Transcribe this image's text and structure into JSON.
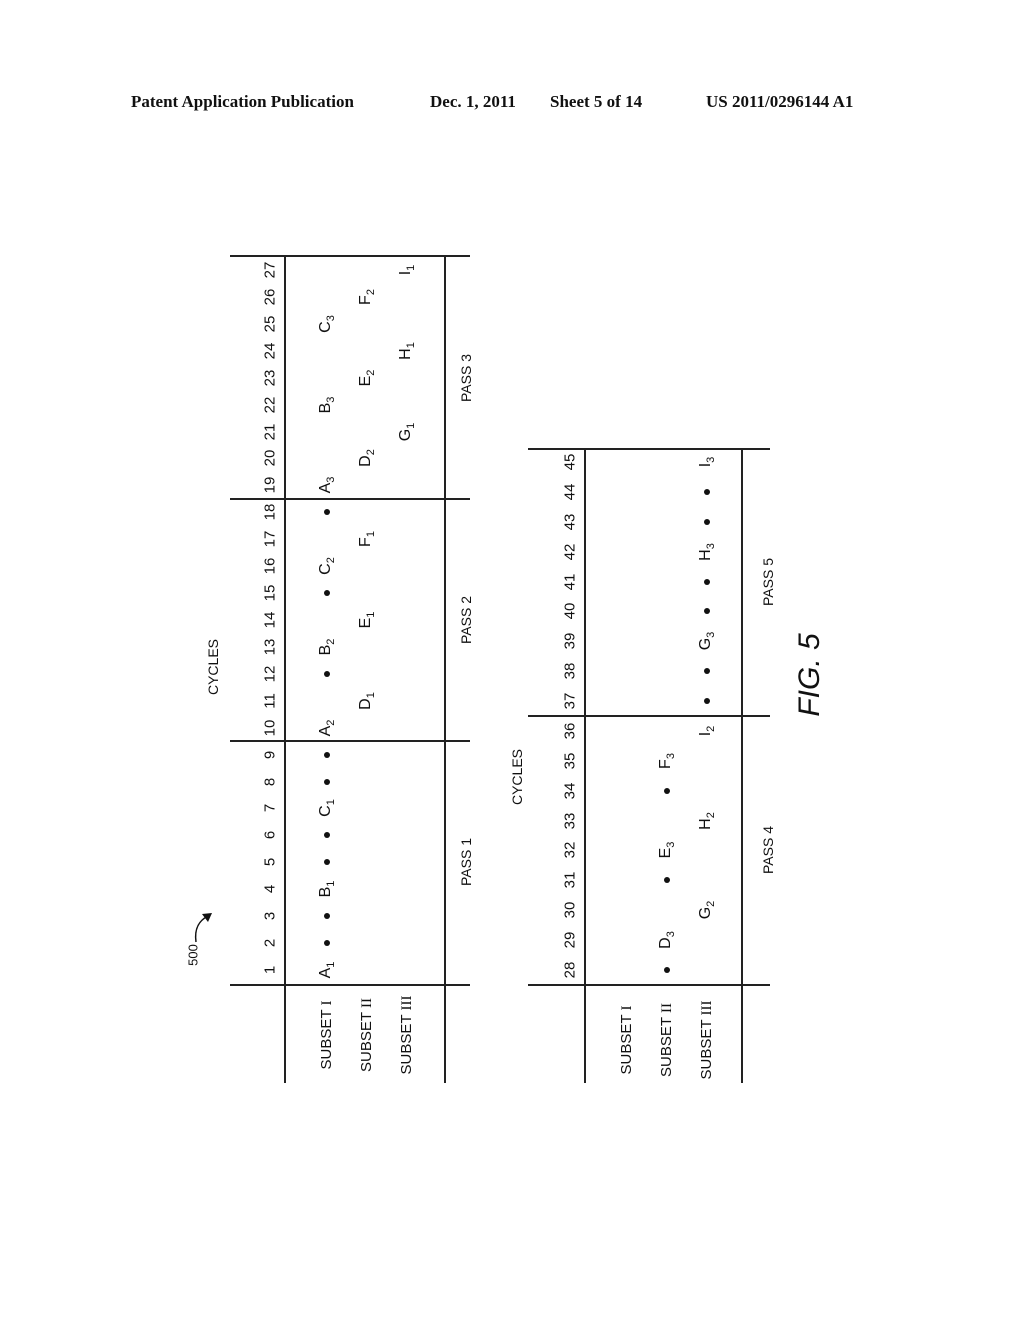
{
  "header": {
    "publication": "Patent Application Publication",
    "date": "Dec. 1, 2011",
    "sheet": "Sheet 5 of 14",
    "number": "US 2011/0296144 A1"
  },
  "figure": {
    "label": "FIG. 5",
    "reference": "500",
    "cycles_label": "CYCLES",
    "subset_labels": [
      "SUBSET I",
      "SUBSET II",
      "SUBSET III"
    ],
    "tables": [
      {
        "cycles": [
          1,
          2,
          3,
          4,
          5,
          6,
          7,
          8,
          9,
          10,
          11,
          12,
          13,
          14,
          15,
          16,
          17,
          18,
          19,
          20,
          21,
          22,
          23,
          24,
          25,
          26,
          27
        ],
        "passes": [
          {
            "label": "PASS 1",
            "from": 1,
            "to": 9
          },
          {
            "label": "PASS 2",
            "from": 10,
            "to": 18
          },
          {
            "label": "PASS 3",
            "from": 19,
            "to": 27
          }
        ],
        "rows": [
          [
            {
              "cycle": 1,
              "text": "A",
              "sub": "1"
            },
            {
              "cycle": 2,
              "dot": true
            },
            {
              "cycle": 3,
              "dot": true
            },
            {
              "cycle": 4,
              "text": "B",
              "sub": "1"
            },
            {
              "cycle": 5,
              "dot": true
            },
            {
              "cycle": 6,
              "dot": true
            },
            {
              "cycle": 7,
              "text": "C",
              "sub": "1"
            },
            {
              "cycle": 8,
              "dot": true
            },
            {
              "cycle": 9,
              "dot": true
            },
            {
              "cycle": 10,
              "text": "A",
              "sub": "2"
            },
            {
              "cycle": 12,
              "dot": true
            },
            {
              "cycle": 13,
              "text": "B",
              "sub": "2"
            },
            {
              "cycle": 15,
              "dot": true
            },
            {
              "cycle": 16,
              "text": "C",
              "sub": "2"
            },
            {
              "cycle": 18,
              "dot": true
            },
            {
              "cycle": 19,
              "text": "A",
              "sub": "3"
            },
            {
              "cycle": 22,
              "text": "B",
              "sub": "3"
            },
            {
              "cycle": 25,
              "text": "C",
              "sub": "3"
            }
          ],
          [
            {
              "cycle": 11,
              "text": "D",
              "sub": "1"
            },
            {
              "cycle": 14,
              "text": "E",
              "sub": "1"
            },
            {
              "cycle": 17,
              "text": "F",
              "sub": "1"
            },
            {
              "cycle": 20,
              "text": "D",
              "sub": "2"
            },
            {
              "cycle": 23,
              "text": "E",
              "sub": "2"
            },
            {
              "cycle": 26,
              "text": "F",
              "sub": "2"
            }
          ],
          [
            {
              "cycle": 21,
              "text": "G",
              "sub": "1"
            },
            {
              "cycle": 24,
              "text": "H",
              "sub": "1"
            },
            {
              "cycle": 27,
              "text": "I",
              "sub": "1"
            }
          ]
        ]
      },
      {
        "cycles": [
          28,
          29,
          30,
          31,
          32,
          33,
          34,
          35,
          36,
          37,
          38,
          39,
          40,
          41,
          42,
          43,
          44,
          45
        ],
        "passes": [
          {
            "label": "PASS 4",
            "from": 28,
            "to": 36
          },
          {
            "label": "PASS 5",
            "from": 37,
            "to": 45
          }
        ],
        "rows": [
          [],
          [
            {
              "cycle": 28,
              "dot": true
            },
            {
              "cycle": 29,
              "text": "D",
              "sub": "3"
            },
            {
              "cycle": 31,
              "dot": true
            },
            {
              "cycle": 32,
              "text": "E",
              "sub": "3"
            },
            {
              "cycle": 34,
              "dot": true
            },
            {
              "cycle": 35,
              "text": "F",
              "sub": "3"
            }
          ],
          [
            {
              "cycle": 30,
              "text": "G",
              "sub": "2"
            },
            {
              "cycle": 33,
              "text": "H",
              "sub": "2"
            },
            {
              "cycle": 36,
              "text": "I",
              "sub": "2"
            },
            {
              "cycle": 37,
              "dot": true
            },
            {
              "cycle": 38,
              "dot": true
            },
            {
              "cycle": 39,
              "text": "G",
              "sub": "3"
            },
            {
              "cycle": 40,
              "dot": true
            },
            {
              "cycle": 41,
              "dot": true
            },
            {
              "cycle": 42,
              "text": "H",
              "sub": "3"
            },
            {
              "cycle": 43,
              "dot": true
            },
            {
              "cycle": 44,
              "dot": true
            },
            {
              "cycle": 45,
              "text": "I",
              "sub": "3"
            }
          ]
        ]
      }
    ]
  }
}
